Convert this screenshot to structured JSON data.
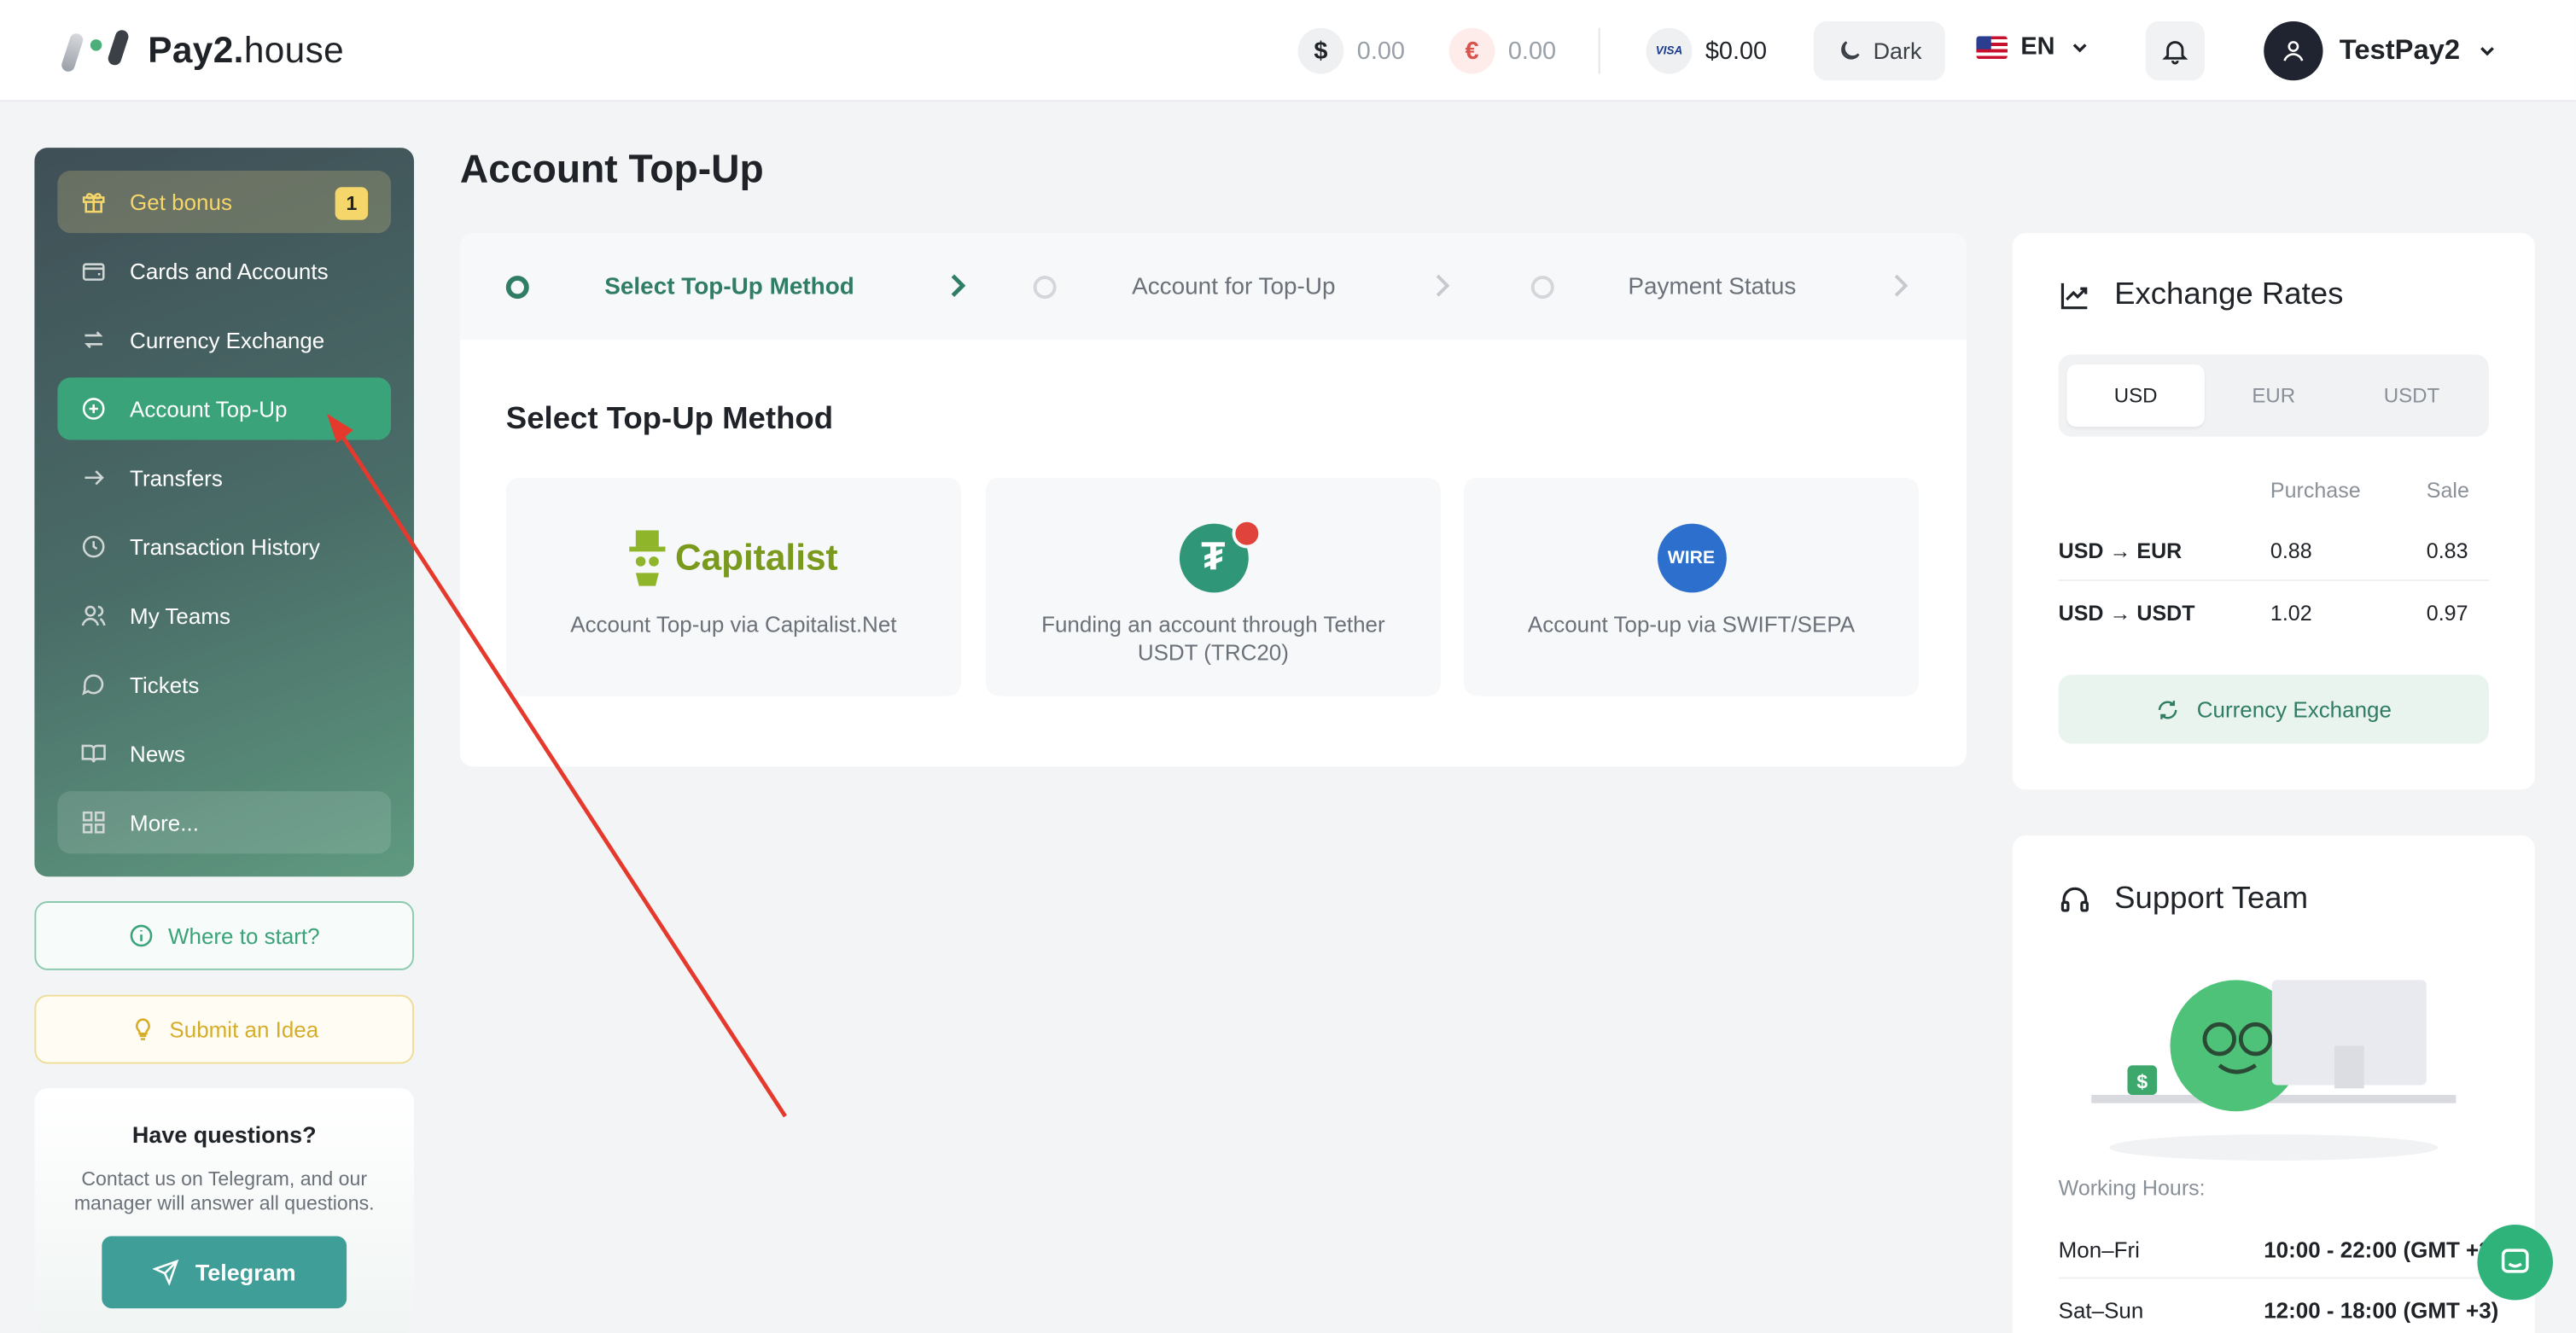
{
  "header": {
    "logo_bold": "Pay2.",
    "logo_light": "house",
    "balances": [
      {
        "symbol": "$",
        "amount": "0.00"
      },
      {
        "symbol": "€",
        "amount": "0.00"
      }
    ],
    "card_badge": "VISA",
    "card_balance": "$0.00",
    "theme_label": "Dark",
    "language": "EN",
    "username": "TestPay2"
  },
  "sidebar": {
    "items": [
      {
        "label": "Get bonus",
        "badge": "1"
      },
      {
        "label": "Cards and Accounts"
      },
      {
        "label": "Currency Exchange"
      },
      {
        "label": "Account Top-Up"
      },
      {
        "label": "Transfers"
      },
      {
        "label": "Transaction History"
      },
      {
        "label": "My Teams"
      },
      {
        "label": "Tickets"
      },
      {
        "label": "News"
      },
      {
        "label": "More..."
      }
    ],
    "where_to_start": "Where to start?",
    "submit_idea": "Submit an Idea",
    "help": {
      "title": "Have questions?",
      "text": "Contact us on Telegram, and our manager will answer all questions.",
      "button": "Telegram"
    }
  },
  "main": {
    "title": "Account Top-Up",
    "steps": [
      "Select Top-Up Method",
      "Account for Top-Up",
      "Payment Status"
    ],
    "section_title": "Select Top-Up Method",
    "methods": [
      {
        "logo_text": "Capitalist",
        "label": "Account Top-up via Capitalist.Net"
      },
      {
        "logo_text": "₮",
        "label": "Funding an account through Tether USDT (TRC20)"
      },
      {
        "logo_text": "WIRE",
        "label": "Account Top-up via SWIFT/SEPA"
      }
    ]
  },
  "rates": {
    "title": "Exchange Rates",
    "tabs": [
      "USD",
      "EUR",
      "USDT"
    ],
    "selected_tab": "USD",
    "col_purchase": "Purchase",
    "col_sale": "Sale",
    "rows": [
      {
        "pair": "USD → EUR",
        "purchase": "0.88",
        "sale": "0.83"
      },
      {
        "pair": "USD → USDT",
        "purchase": "1.02",
        "sale": "0.97"
      }
    ],
    "button": "Currency Exchange"
  },
  "support": {
    "title": "Support Team",
    "hours_label": "Working Hours:",
    "hours": [
      {
        "days": "Mon–Fri",
        "time": "10:00 - 22:00 (GMT +3)"
      },
      {
        "days": "Sat–Sun",
        "time": "12:00 - 18:00 (GMT +3)"
      }
    ]
  },
  "colors": {
    "accent": "#3aa37a",
    "annotation_arrow": "#e5392d"
  }
}
